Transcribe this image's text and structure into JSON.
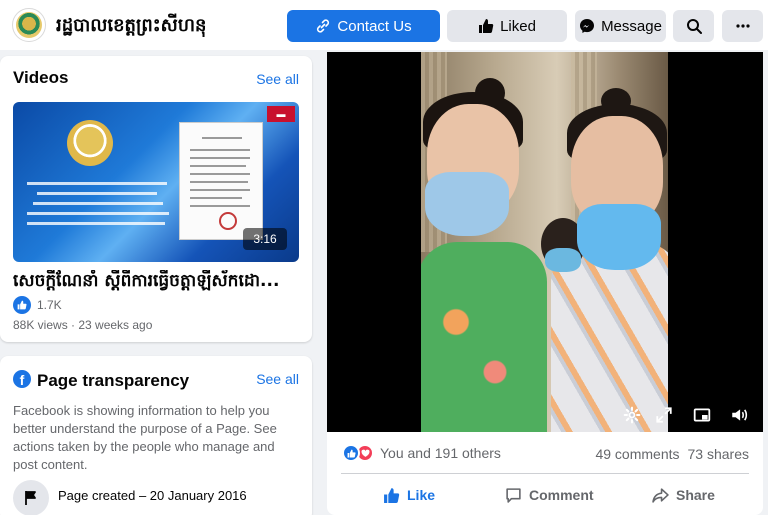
{
  "header": {
    "page_name": "រដ្ឋបាលខេត្តព្រះសីហនុ",
    "buttons": {
      "contact": "Contact Us",
      "liked": "Liked",
      "message": "Message"
    }
  },
  "videos": {
    "title": "Videos",
    "see_all": "See all",
    "item": {
      "duration": "3:16",
      "title": "សេចក្តីណែនាំ ស្តីពីការធ្វើចត្តាឡីស័កដោ...",
      "likes": "1.7K",
      "meta": "88K views · 23 weeks ago"
    }
  },
  "transparency": {
    "title": "Page transparency",
    "see_all": "See all",
    "description": "Facebook is showing information to help you better understand the purpose of a Page. See actions taken by the people who manage and post content.",
    "page_created": "Page created – 20 January 2016"
  },
  "post": {
    "reactions_text": "You and 191 others",
    "comments": "49 comments",
    "shares": "73 shares",
    "actions": {
      "like": "Like",
      "comment": "Comment",
      "share": "Share"
    }
  },
  "icons": {
    "contact": "link-icon",
    "liked": "thumbs-up-icon",
    "message": "messenger-icon",
    "search": "search-icon",
    "more": "more-icon",
    "settings": "gear-icon",
    "fullscreen": "expand-icon",
    "pip": "picture-in-picture-icon",
    "volume": "volume-icon"
  },
  "colors": {
    "accent": "#1b74e4",
    "love": "#f33e58"
  }
}
